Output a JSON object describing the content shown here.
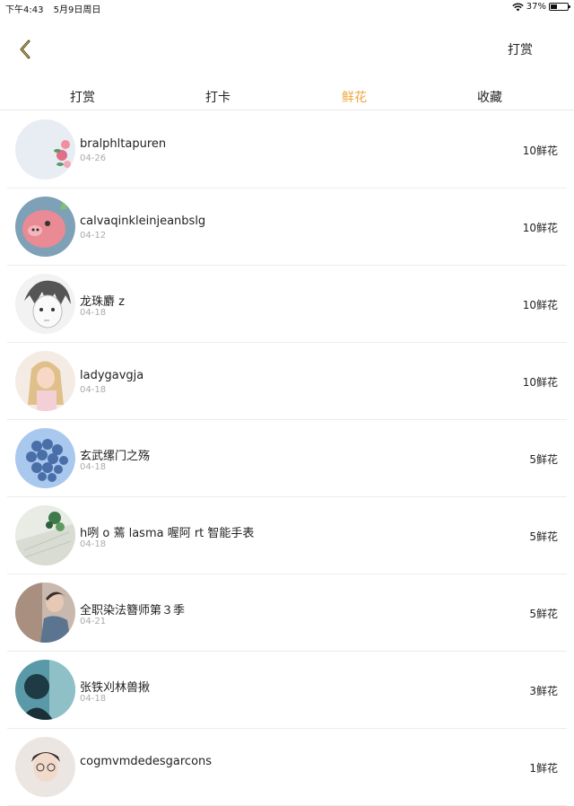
{
  "status_bar": {
    "time": "下午4:43",
    "date": "5月9日周日",
    "battery": "37%",
    "battery_level": 0.37
  },
  "nav": {
    "action_label": "打赏"
  },
  "tabs": [
    {
      "label": "打赏",
      "active": false
    },
    {
      "label": "打卡",
      "active": false
    },
    {
      "label": "鲜花",
      "active": true
    },
    {
      "label": "收藏",
      "active": false
    }
  ],
  "accent_color": "#f0a53a",
  "items": [
    {
      "name": "bralphltapuren",
      "date": "04-26",
      "amount": "10鲜花",
      "avatar": "flowers"
    },
    {
      "name": "calvaqinkleinjeanbslg",
      "date": "04-12",
      "amount": "10鲜花",
      "avatar": "pig"
    },
    {
      "name": "龙珠麝 z",
      "date": "04-18",
      "amount": "10鲜花",
      "avatar": "anime"
    },
    {
      "name": "ladygavgja",
      "date": "04-18",
      "amount": "10鲜花",
      "avatar": "girl"
    },
    {
      "name": "玄武缧门之殇",
      "date": "04-18",
      "amount": "5鲜花",
      "avatar": "berries"
    },
    {
      "name": "h咧 o 蔫 lasma 喔阿 rt 智能手表",
      "date": "04-18",
      "amount": "5鲜花",
      "avatar": "plant"
    },
    {
      "name": "全职染法簪师第３季",
      "date": "04-21",
      "amount": "5鲜花",
      "avatar": "man"
    },
    {
      "name": "张铁刈林兽揪",
      "date": "04-18",
      "amount": "3鲜花",
      "avatar": "teal"
    },
    {
      "name": "cogmvmdedesgarcons",
      "date": "",
      "amount": "1鲜花",
      "avatar": "glasses"
    }
  ]
}
